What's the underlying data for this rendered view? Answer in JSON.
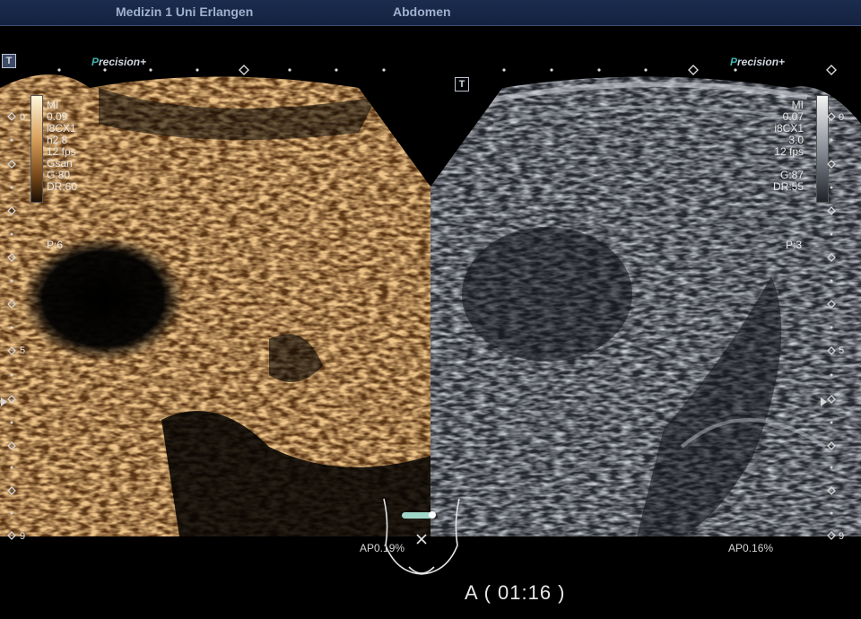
{
  "header": {
    "site": "Medizin 1 Uni Erlangen",
    "preset": "Abdomen"
  },
  "left_panel": {
    "brand": "recision+",
    "brand_letter": "P",
    "params": [
      "MI",
      "0.09",
      "i8CX1",
      "h2.8",
      "12 fps",
      "Gsan",
      "G:80",
      "DR:60"
    ],
    "persistence": "P:6",
    "ap": "AP0.19%",
    "colormap": "amber"
  },
  "right_panel": {
    "brand": "recision+",
    "brand_letter": "P",
    "params": [
      "MI",
      "0.07",
      "i8CX1",
      "3.0",
      "12 fps",
      "",
      "G:87",
      "DR:55"
    ],
    "persistence": "P:3",
    "ap": "AP0.16%",
    "colormap": "grayscale"
  },
  "depth_scale": {
    "top": "0",
    "mid": "5",
    "bottom": "9"
  },
  "t_label": "T",
  "timer": "A  ( 01:16 )",
  "colors": {
    "amber": "#d79a55",
    "gray": "#8b9098",
    "teal": "#3fb3b0"
  }
}
